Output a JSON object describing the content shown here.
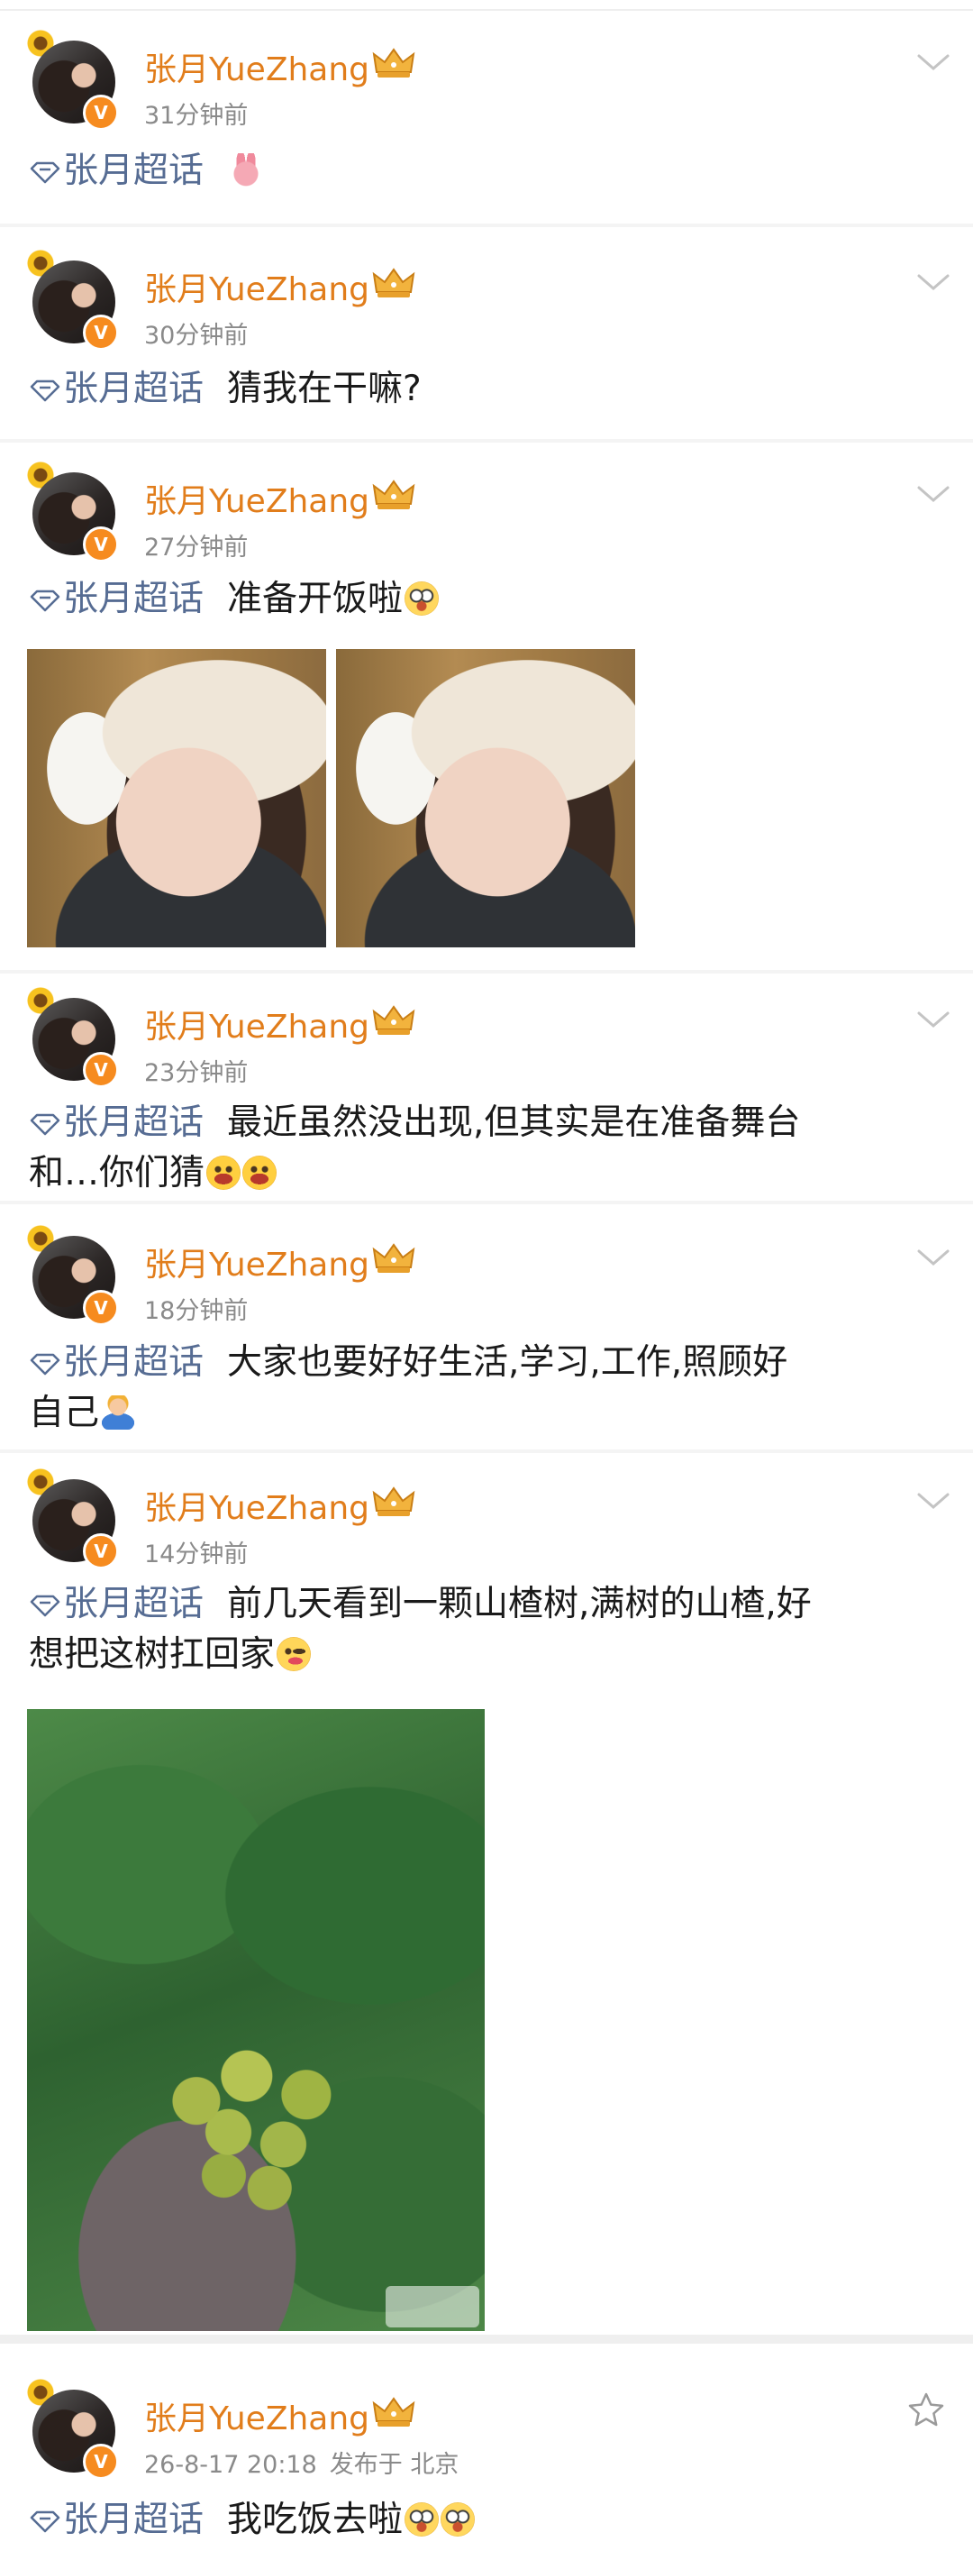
{
  "colors": {
    "username": "#e17d1b",
    "topic": "#566c93",
    "timestamp": "#8a8a8a",
    "verified_badge": "#f68b1f"
  },
  "posts": [
    {
      "username": "张月YueZhang",
      "time": "31分钟前",
      "topic": "张月超话",
      "text": "",
      "emojis": [
        "rabbit"
      ]
    },
    {
      "username": "张月YueZhang",
      "time": "30分钟前",
      "topic": "张月超话",
      "text": "猜我在干嘛?"
    },
    {
      "username": "张月YueZhang",
      "time": "27分钟前",
      "topic": "张月超话",
      "text": "准备开饭啦",
      "emojis": [
        "cry"
      ],
      "images": 2
    },
    {
      "username": "张月YueZhang",
      "time": "23分钟前",
      "topic": "张月超话",
      "text": "最近虽然没出现,但其实是在准备舞台",
      "text_line2": "和…你们猜",
      "emojis": [
        "laugh",
        "laugh"
      ]
    },
    {
      "username": "张月YueZhang",
      "time": "18分钟前",
      "topic": "张月超话",
      "text": "大家也要好好生活,学习,工作,照顾好",
      "text_line2": "自己",
      "emojis": [
        "shrug"
      ]
    },
    {
      "username": "张月YueZhang",
      "time": "14分钟前",
      "topic": "张月超话",
      "text": "前几天看到一颗山楂树,满树的山楂,好",
      "text_line2": "想把这树扛回家",
      "emojis": [
        "wink"
      ],
      "images": 1
    },
    {
      "username": "张月YueZhang",
      "time": "26-8-17 20:18",
      "location": "发布于 北京",
      "topic": "张月超话",
      "text": "我吃饭去啦",
      "emojis": [
        "cry",
        "cry"
      ]
    }
  ]
}
